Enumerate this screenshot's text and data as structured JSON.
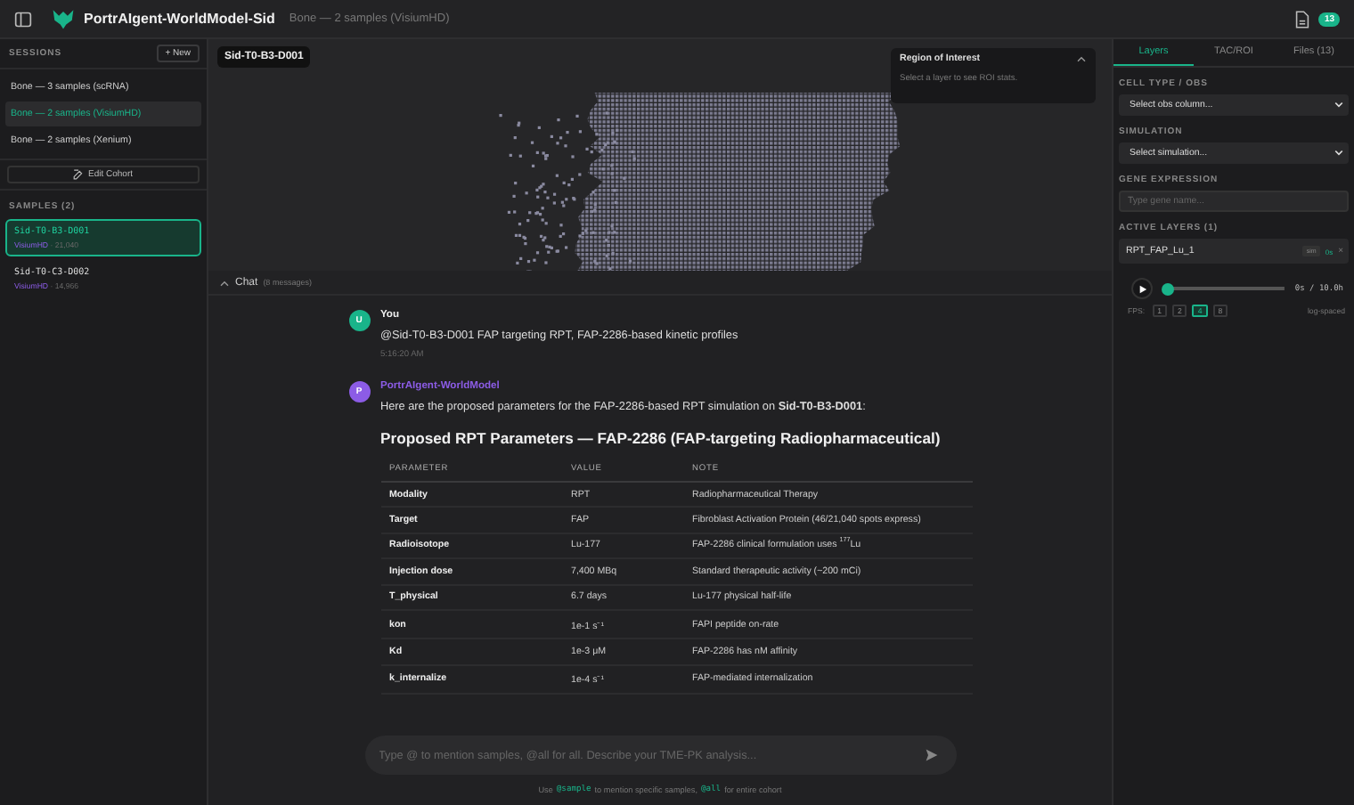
{
  "header": {
    "title": "PortrAIgent-WorldModel-Sid",
    "subtitle": "Bone — 2 samples (VisiumHD)",
    "badge": "13"
  },
  "sessions": {
    "heading": "SESSIONS",
    "new_button": "+ New",
    "items": [
      {
        "label": "Bone — 3 samples (scRNA)",
        "selected": false
      },
      {
        "label": "Bone — 2 samples (VisiumHD)",
        "selected": true
      },
      {
        "label": "Bone — 2 samples (Xenium)",
        "selected": false
      }
    ],
    "edit_button": "Edit Cohort"
  },
  "samples": {
    "heading": "SAMPLES (2)",
    "items": [
      {
        "name": "Sid-T0-B3-D001",
        "platform": "VisiumHD",
        "spots": "· 21,040",
        "selected": true
      },
      {
        "name": "Sid-T0-C3-D002",
        "platform": "VisiumHD",
        "spots": "· 14,966",
        "selected": false
      }
    ]
  },
  "viewer": {
    "sample_tag": "Sid-T0-B3-D001",
    "roi": {
      "title": "Region of Interest",
      "hint": "Select a layer to see ROI stats."
    }
  },
  "chat": {
    "title": "Chat",
    "count": "(8 messages)",
    "messages": [
      {
        "kind": "user",
        "avatar": "U",
        "author": "You",
        "text": "@Sid-T0-B3-D001 FAP targeting RPT, FAP-2286-based kinetic profiles",
        "time": "5:16:20 AM"
      },
      {
        "kind": "assistant",
        "avatar": "P",
        "author": "PortrAIgent-WorldModel",
        "text": "Here are the proposed parameters for the FAP-2286-based RPT simulation on **Sid-T0-B3-D001**:",
        "heading": "Proposed RPT Parameters — FAP-2286 (FAP-targeting Radiopharmaceutical)",
        "table": {
          "columns": [
            "PARAMETER",
            "VALUE",
            "NOTE"
          ],
          "rows": [
            [
              "Modality",
              "RPT",
              "Radiopharmaceutical Therapy"
            ],
            [
              "Target",
              "FAP",
              "Fibroblast Activation Protein (46/21,040 spots express)"
            ],
            [
              "Radioisotope",
              "Lu-177",
              "FAP-2286 clinical formulation uses $^{177}$Lu"
            ],
            [
              "Injection dose",
              "7,400 MBq",
              "Standard therapeutic activity (~200 mCi)"
            ],
            [
              "T_physical",
              "6.7 days",
              "Lu-177 physical half-life"
            ],
            [
              "kon",
              "1e-1 s⁻¹",
              "FAPI peptide on-rate"
            ],
            [
              "Kd",
              "1e-3 μM",
              "FAP-2286 has nM affinity"
            ],
            [
              "k_internalize",
              "1e-4 s⁻¹",
              "FAP-mediated internalization"
            ]
          ]
        }
      }
    ],
    "input": {
      "placeholder": "Type @ to mention samples, @all for all. Describe your TME-PK analysis..."
    },
    "hint": [
      {
        "kind": "text",
        "text": "Use"
      },
      {
        "kind": "code",
        "text": "@sample"
      },
      {
        "kind": "text",
        "text": "to mention specific samples,"
      },
      {
        "kind": "code",
        "text": "@all"
      },
      {
        "kind": "text",
        "text": "for entire cohort"
      }
    ]
  },
  "right": {
    "tabs": [
      {
        "label": "Layers",
        "selected": true
      },
      {
        "label": "TAC/ROI",
        "selected": false
      },
      {
        "label": "Files (13)",
        "selected": false
      }
    ],
    "cell_type": {
      "label": "CELL TYPE / OBS",
      "value": "Select obs column..."
    },
    "simulation": {
      "label": "SIMULATION",
      "value": "Select simulation..."
    },
    "gene": {
      "label": "GENE EXPRESSION",
      "placeholder": "Type gene name..."
    },
    "active_layers": {
      "heading": "ACTIVE LAYERS (1)",
      "items": [
        {
          "name": "RPT_FAP_Lu_1",
          "tag": "sim",
          "time": "0s",
          "close": "×"
        }
      ]
    },
    "player": {
      "level": 0,
      "time": "0s / 10.0h",
      "fps_label": "FPS:",
      "fps": [
        {
          "label": "1",
          "selected": false
        },
        {
          "label": "2",
          "selected": false
        },
        {
          "label": "4",
          "selected": true
        },
        {
          "label": "8",
          "selected": false
        }
      ],
      "scale": "log-spaced"
    }
  }
}
